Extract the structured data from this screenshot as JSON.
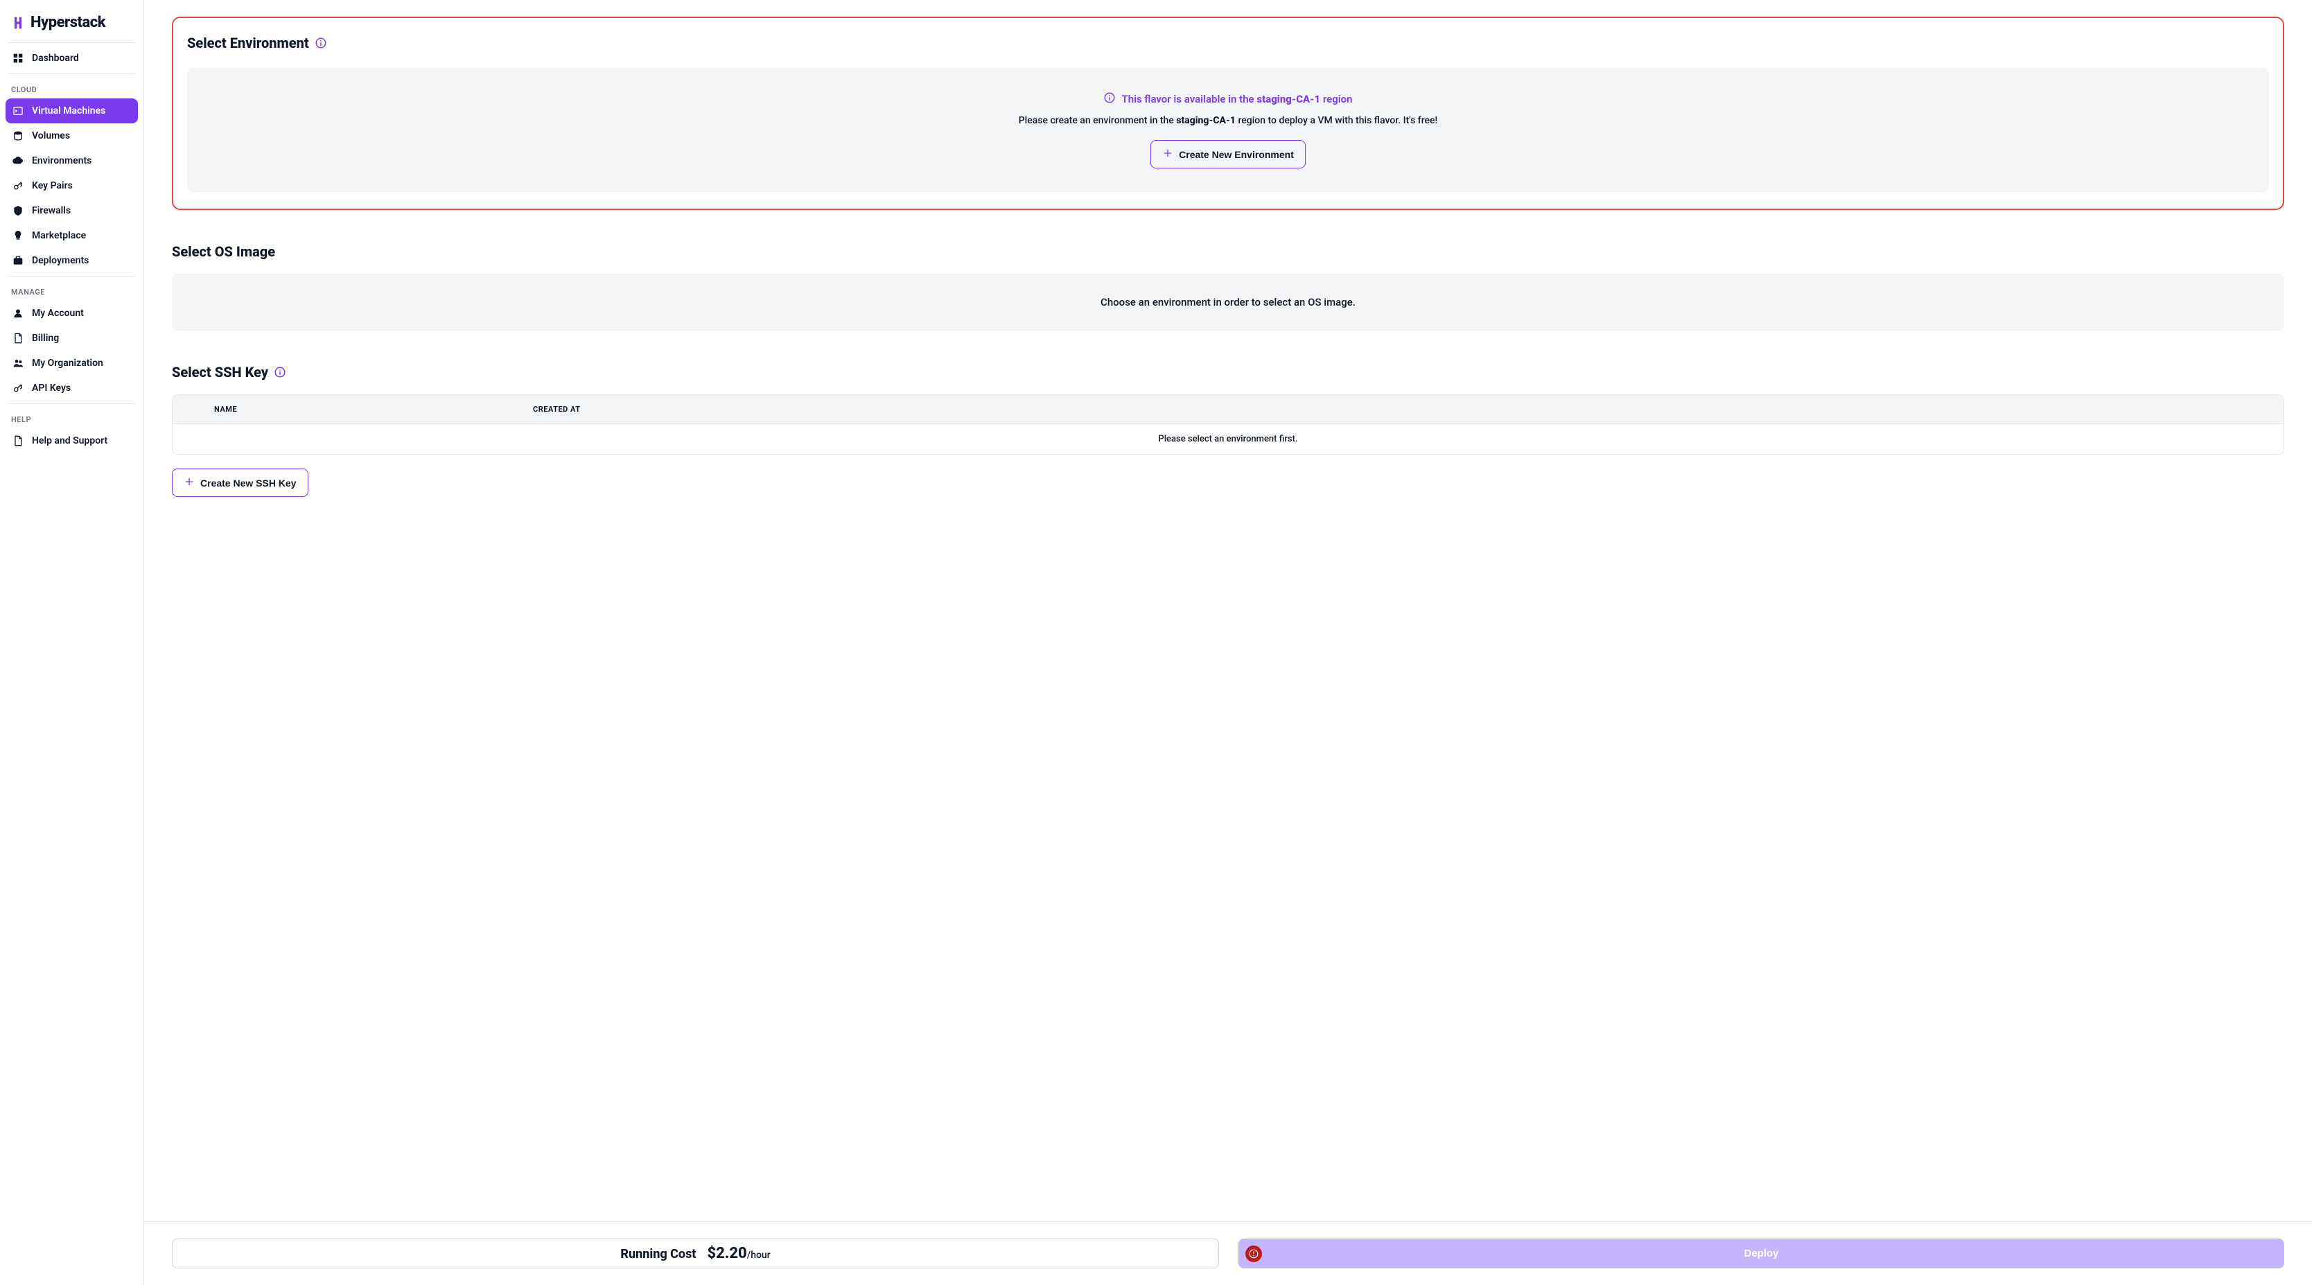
{
  "brand": {
    "name": "Hyperstack"
  },
  "sidebar": {
    "dashboard": "Dashboard",
    "section_cloud": "CLOUD",
    "cloud": [
      {
        "label": "Virtual Machines",
        "active": true
      },
      {
        "label": "Volumes"
      },
      {
        "label": "Environments"
      },
      {
        "label": "Key Pairs"
      },
      {
        "label": "Firewalls"
      },
      {
        "label": "Marketplace"
      },
      {
        "label": "Deployments"
      }
    ],
    "section_manage": "MANAGE",
    "manage": [
      {
        "label": "My Account"
      },
      {
        "label": "Billing"
      },
      {
        "label": "My Organization"
      },
      {
        "label": "API Keys"
      }
    ],
    "section_help": "HELP",
    "help": [
      {
        "label": "Help and Support"
      }
    ]
  },
  "env": {
    "title": "Select Environment",
    "flavor_prefix": "This flavor is available in the ",
    "flavor_region": "staging-CA-1",
    "flavor_suffix": " region",
    "desc_prefix": "Please create an environment in the ",
    "desc_region": "staging-CA-1",
    "desc_suffix": " region to deploy a VM with this flavor. It's free!",
    "create_btn": "Create New Environment"
  },
  "os": {
    "title": "Select OS Image",
    "empty": "Choose an environment in order to select an OS image."
  },
  "ssh": {
    "title": "Select SSH Key",
    "col_name": "NAME",
    "col_created": "CREATED AT",
    "empty": "Please select an environment first.",
    "create_btn": "Create New SSH Key"
  },
  "footer": {
    "cost_label": "Running Cost",
    "cost_value": "$2.20",
    "cost_unit": "/hour",
    "deploy": "Deploy"
  }
}
